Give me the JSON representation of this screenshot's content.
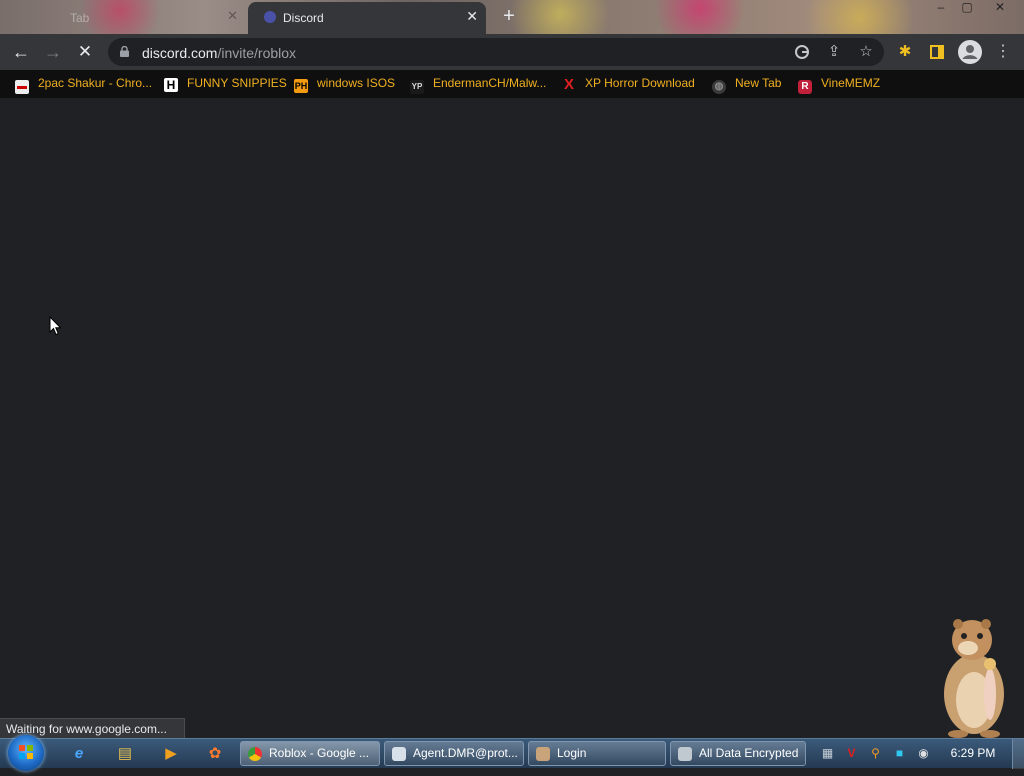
{
  "tabs": [
    {
      "title": "Tab",
      "active": false
    },
    {
      "title": "Discord",
      "active": true
    }
  ],
  "window_controls": {
    "minimize": "–",
    "maximize": "▢",
    "close": "✕"
  },
  "toolbar": {
    "url_host": "discord.com",
    "url_path": "/invite/roblox",
    "loading": true
  },
  "bookmarks": [
    {
      "label": "2pac Shakur - Chro...",
      "icon": "2pac-favicon"
    },
    {
      "label": "FUNNY SNIPPIES",
      "icon": "H"
    },
    {
      "label": "windows ISOS",
      "icon": "PH"
    },
    {
      "label": "EndermanCH/Malw...",
      "icon": "YP"
    },
    {
      "label": "XP Horror Download",
      "icon": "X"
    },
    {
      "label": "New Tab",
      "icon": "globe-icon"
    },
    {
      "label": "VineMEMZ",
      "icon": "R"
    }
  ],
  "status_bubble": "Waiting for www.google.com...",
  "taskbar": {
    "tasks": [
      {
        "label": "Roblox - Google ..."
      },
      {
        "label": "Agent.DMR@prot..."
      },
      {
        "label": "Login"
      },
      {
        "label": "All Data Encrypted"
      }
    ],
    "clock": "6:29 PM"
  },
  "colors": {
    "page_background": "#202124",
    "toolbar": "#35363a",
    "bookmark_text": "#f0b020"
  }
}
